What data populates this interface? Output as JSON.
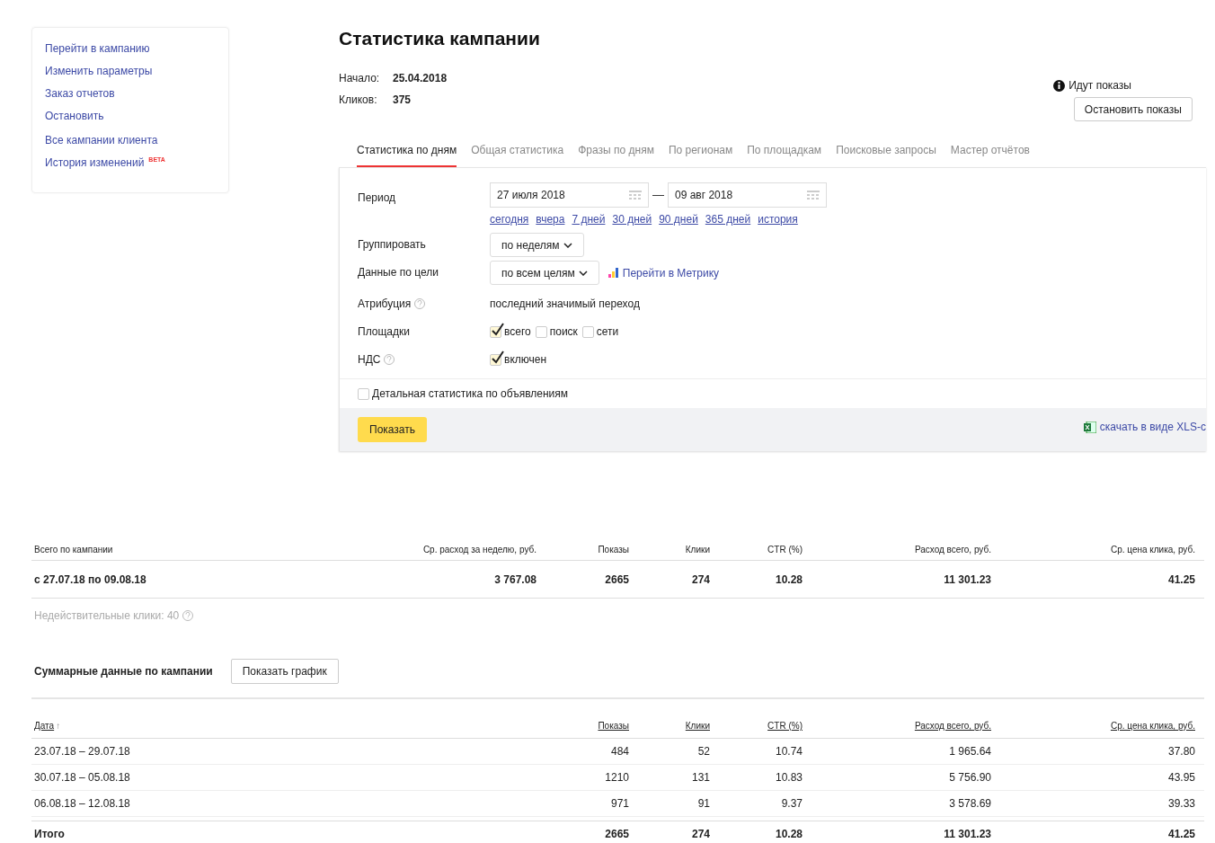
{
  "sidebar": {
    "groups": [
      [
        "Перейти в кампанию",
        "Изменить параметры",
        "Заказ отчетов",
        "Остановить"
      ],
      [
        "Все кампании клиента",
        "История изменений"
      ]
    ],
    "badge": "BETA"
  },
  "title": "Статистика кампании",
  "meta": [
    {
      "label": "Начало:",
      "value": "25.04.2018"
    },
    {
      "label": "Кликов:",
      "value": "375"
    }
  ],
  "status": {
    "text": "Идут показы",
    "button": "Остановить показы"
  },
  "tabs": [
    {
      "label": "Статистика по дням",
      "selected": true
    },
    {
      "label": "Общая статистика",
      "selected": false
    },
    {
      "label": "Фразы по дням",
      "selected": false
    },
    {
      "label": "По регионам",
      "selected": false
    },
    {
      "label": "По площадкам",
      "selected": false
    },
    {
      "label": "Поисковые запросы",
      "selected": false
    },
    {
      "label": "Мастер отчётов",
      "selected": false
    }
  ],
  "form": {
    "period": {
      "label": "Период",
      "from": "27 июля 2018",
      "dash": "—",
      "to": "09 авг 2018",
      "presets": [
        "сегодня",
        "вчера",
        "7 дней",
        "30 дней",
        "90 дней",
        "365 дней",
        "история"
      ]
    },
    "group": {
      "label": "Группировать",
      "value": "по неделям"
    },
    "goal": {
      "label": "Данные по цели",
      "value": "по всем целям",
      "link": "Перейти в Метрику"
    },
    "attribution": {
      "label": "Атрибуция",
      "value": "последний значимый переход"
    },
    "platforms": {
      "label": "Площадки",
      "options": [
        {
          "label": "всего",
          "checked": true
        },
        {
          "label": "поиск",
          "checked": false
        },
        {
          "label": "сети",
          "checked": false
        }
      ]
    },
    "vat": {
      "label": "НДС",
      "options": [
        {
          "label": "включен",
          "checked": true
        }
      ]
    },
    "detailed": {
      "label": "Детальная статистика по объявлениям",
      "checked": false
    },
    "submit": "Показать",
    "download": "скачать в виде XLS-с"
  },
  "summary": {
    "columns": [
      "Всего по кампании",
      "Ср. расход за неделю, руб.",
      "Показы",
      "Клики",
      "CTR (%)",
      "Расход всего, руб.",
      "Ср. цена клика, руб."
    ],
    "row": [
      "с 27.07.18 по 09.08.18",
      "3 767.08",
      "2665",
      "274",
      "10.28",
      "11 301.23",
      "41.25"
    ],
    "invalid": "Недействительные клики: 40"
  },
  "totals_title": "Суммарные данные по кампании",
  "chart_button": "Показать график",
  "table": {
    "columns": [
      "Дата",
      "Показы",
      "Клики",
      "CTR (%)",
      "Расход всего, руб.",
      "Ср. цена клика, руб."
    ],
    "sort_arrow": "↑",
    "rows": [
      [
        "23.07.18 – 29.07.18",
        "484",
        "52",
        "10.74",
        "1 965.64",
        "37.80"
      ],
      [
        "30.07.18 – 05.08.18",
        "1210",
        "131",
        "10.83",
        "5 756.90",
        "43.95"
      ],
      [
        "06.08.18 – 12.08.18",
        "971",
        "91",
        "9.37",
        "3 578.69",
        "39.33"
      ]
    ],
    "total": [
      "Итого",
      "2665",
      "274",
      "10.28",
      "11 301.23",
      "41.25"
    ]
  }
}
